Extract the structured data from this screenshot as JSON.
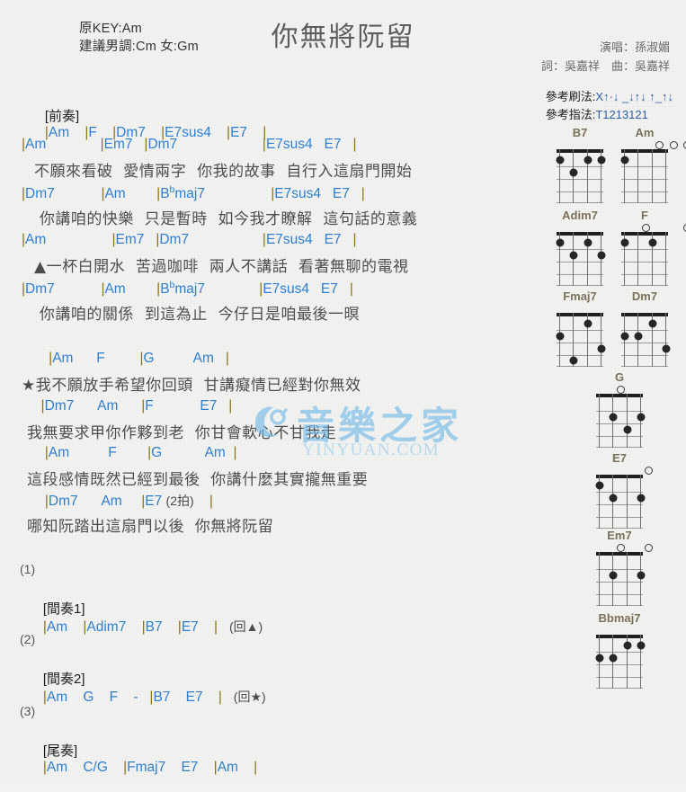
{
  "header": {
    "key_original": "原KEY:Am",
    "key_suggested": "建議男調:Cm 女:Gm",
    "title": "你無將阮留",
    "singer": "演唱：孫淑媚",
    "writers": "詞：吳嘉祥　曲：吳嘉祥",
    "strum_label": "參考刷法:",
    "strum_value": "X↑·↓ _↓↑↓ ↑_↑↓",
    "finger_label": "參考指法:",
    "finger_value": "T1213121"
  },
  "watermark": {
    "chinese": "音樂之家",
    "english": "YINYUAN.COM",
    "logo_icon": "music-note-logo"
  },
  "sections": {
    "intro": {
      "label": "[前奏]",
      "chords": "|Am    |F    |Dm7    |E7sus4    |E7    |"
    },
    "verse1": [
      {
        "chords": "|Am              |Em7   |Dm7                      |E7sus4   E7   |",
        "lyrics": "不願來看破  愛情兩字  你我的故事  自行入這扇門開始"
      },
      {
        "chords": "|Dm7            |Am        |Bbmaj7                 |E7sus4   E7   |",
        "lyrics": " 你講咱的快樂  只是暫時  如今我才瞭解  這句話的意義"
      },
      {
        "chords": "|Am                 |Em7   |Dm7                   |E7sus4   E7   |",
        "lyrics": "▲一杯白開水  苦過咖啡  兩人不講話  看著無聊的電視"
      },
      {
        "chords": "|Dm7            |Am        |Bbmaj7              |E7sus4   E7   |",
        "lyrics": " 你講咱的關係  到這為止  今仔日是咱最後一暝"
      }
    ],
    "chorus": [
      {
        "chords": "       |Am      F         |G          Am   |",
        "lyrics": "★我不願放手希望你回頭  甘講癡情已經對你無效"
      },
      {
        "chords": "     |Dm7      Am      |F            E7   |",
        "lyrics": "我無要求甲你作夥到老  你甘會軟心不甘我走"
      },
      {
        "chords": "      |Am          F        |G           Am  |",
        "lyrics": "這段感情既然已經到最後  你講什麼其實攏無重要"
      },
      {
        "chords": "      |Dm7      Am     |E7 (2拍)    |",
        "lyrics": "哪知阮踏出這扇門以後  你無將阮留"
      }
    ],
    "interlude1": {
      "number": "(1)",
      "label": "[間奏1]",
      "chords": "|Am    |Adim7    |B7    |E7    |   (回▲)"
    },
    "interlude2": {
      "number": "(2)",
      "label": "[間奏2]",
      "chords": "|Am    G    F    -   |B7    E7    |   (回★)"
    },
    "outro": {
      "number": "(3)",
      "label": "[尾奏]",
      "chords": "|Am    C/G    |Fmaj7    E7    |Am    |"
    }
  },
  "chord_diagrams": [
    {
      "name": "B7",
      "open": [],
      "dots": [
        [
          1,
          4
        ],
        [
          1,
          2
        ],
        [
          1,
          1
        ],
        [
          2,
          3
        ]
      ]
    },
    {
      "name": "Am",
      "open": [
        3,
        2,
        1
      ],
      "dots": [
        [
          1,
          4
        ]
      ]
    },
    {
      "name": "Adim7",
      "open": [],
      "dots": [
        [
          1,
          4
        ],
        [
          1,
          2
        ],
        [
          2,
          3
        ],
        [
          2,
          1
        ]
      ]
    },
    {
      "name": "F",
      "open": [
        4,
        1
      ],
      "dots": [
        [
          1,
          2
        ],
        [
          1,
          4
        ]
      ]
    },
    {
      "name": "Fmaj7",
      "open": [],
      "dots": [
        [
          1,
          2
        ],
        [
          2,
          4
        ],
        [
          3,
          1
        ],
        [
          4,
          3
        ]
      ]
    },
    {
      "name": "Dm7",
      "open": [],
      "dots": [
        [
          1,
          2
        ],
        [
          2,
          4
        ],
        [
          2,
          3
        ],
        [
          3,
          1
        ]
      ]
    },
    {
      "name": "G",
      "open": [
        4
      ],
      "dots": [
        [
          2,
          3
        ],
        [
          2,
          1
        ],
        [
          3,
          2
        ]
      ]
    },
    {
      "name": "E7",
      "open": [
        2
      ],
      "dots": [
        [
          1,
          4
        ],
        [
          2,
          3
        ],
        [
          2,
          1
        ]
      ]
    },
    {
      "name": "Em7",
      "open": [
        4,
        2
      ],
      "dots": [
        [
          2,
          3
        ],
        [
          2,
          1
        ]
      ]
    },
    {
      "name": "Bbmaj7",
      "open": [],
      "dots": [
        [
          1,
          2
        ],
        [
          1,
          1
        ],
        [
          2,
          4
        ],
        [
          2,
          3
        ]
      ]
    }
  ]
}
